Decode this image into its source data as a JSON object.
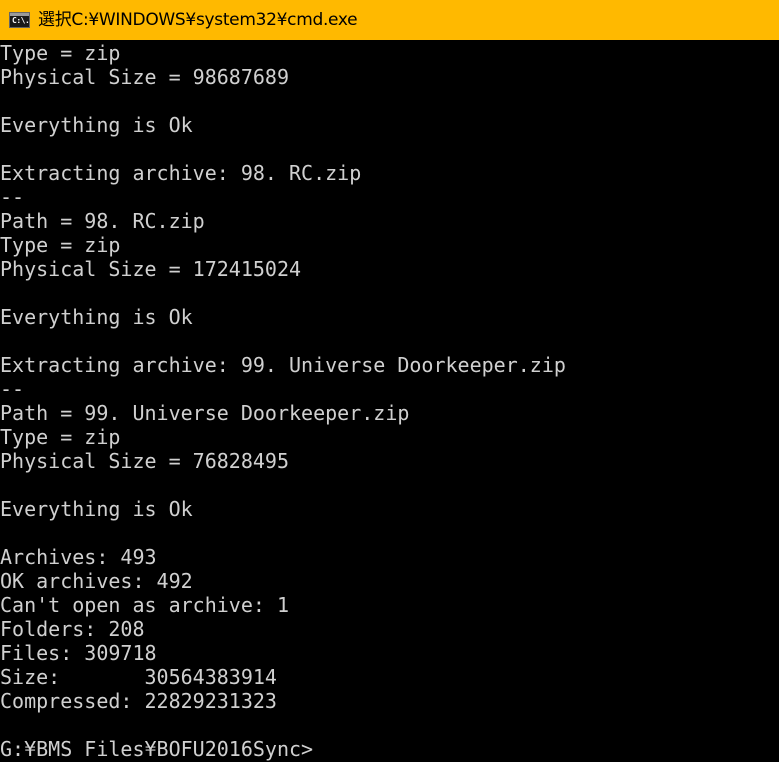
{
  "window": {
    "title": "選択C:¥WINDOWS¥system32¥cmd.exe",
    "icon_text": "C:\\.",
    "accent_color": "#ffb900",
    "background_color": "#000000",
    "text_color": "#d0d0d0"
  },
  "console": {
    "lines": [
      "Type = zip",
      "Physical Size = 98687689",
      "",
      "Everything is Ok",
      "",
      "Extracting archive: 98. RC.zip",
      "--",
      "Path = 98. RC.zip",
      "Type = zip",
      "Physical Size = 172415024",
      "",
      "Everything is Ok",
      "",
      "Extracting archive: 99. Universe Doorkeeper.zip",
      "--",
      "Path = 99. Universe Doorkeeper.zip",
      "Type = zip",
      "Physical Size = 76828495",
      "",
      "Everything is Ok",
      "",
      "Archives: 493",
      "OK archives: 492",
      "Can't open as archive: 1",
      "Folders: 208",
      "Files: 309718",
      "Size:       30564383914",
      "Compressed: 22829231323",
      "",
      "G:¥BMS Files¥BOFU2016Sync>"
    ]
  }
}
